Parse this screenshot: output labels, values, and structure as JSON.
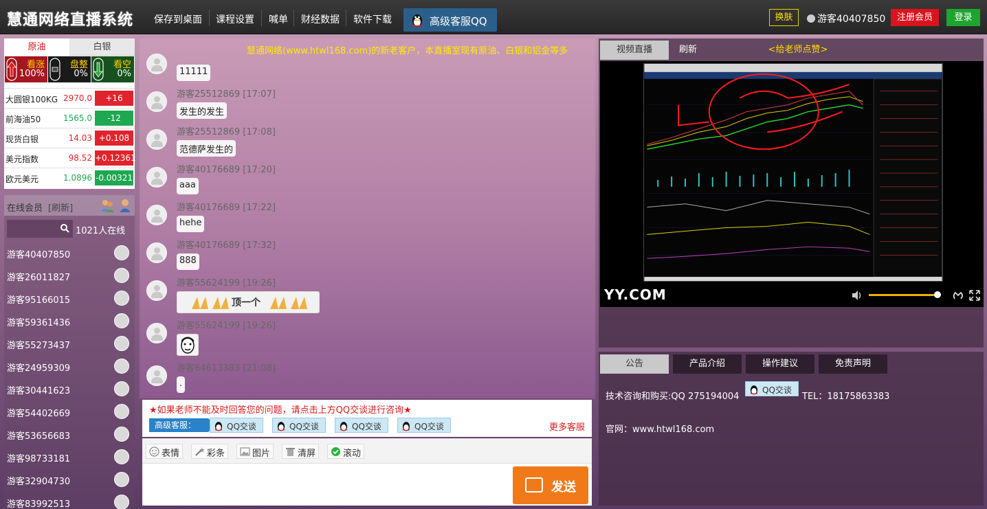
{
  "header": {
    "logo": "慧通网络直播系统",
    "nav": [
      "保存到桌面",
      "课程设置",
      "喊单",
      "财经数据",
      "软件下载"
    ],
    "qq_service": "高级客服QQ",
    "skin": "换肤",
    "username": "游客40407850",
    "register": "注册会员",
    "login": "登录"
  },
  "market": {
    "tabs": [
      "原油",
      "白银"
    ],
    "sentiment": [
      {
        "label": "看涨",
        "pct": "100%"
      },
      {
        "label": "盘整",
        "pct": "0%"
      },
      {
        "label": "看空",
        "pct": "0%"
      }
    ],
    "quotes": [
      {
        "name": "大圆银100KG",
        "price": "2970.0",
        "change": "+16"
      },
      {
        "name": "前海油50",
        "price": "1565.0",
        "change": "-12"
      },
      {
        "name": "现货白银",
        "price": "14.03",
        "change": "+0.108"
      },
      {
        "name": "美元指数",
        "price": "98.52",
        "change": "+0.12361"
      },
      {
        "name": "欧元美元",
        "price": "1.0896",
        "change": "-0.00321"
      }
    ],
    "colors": {
      "up": "#e0242e",
      "down": "#1ea852"
    }
  },
  "online": {
    "title": "在线会员",
    "refresh": "[刷新]",
    "count": "1021人在线",
    "users": [
      "游客40407850",
      "游客26011827",
      "游客95166015",
      "游客59361436",
      "游客55273437",
      "游客24959309",
      "游客30441623",
      "游客54402669",
      "游客53656683",
      "游客98733181",
      "游客32904730",
      "游客83992513"
    ]
  },
  "chat": {
    "marquee": "慧通网络(www.htwl168.com)的新老客户，本直播室现有原油、白银和铝金等多",
    "messages": [
      {
        "meta": "",
        "text": "11111"
      },
      {
        "meta": "游客25512869 [17:07]",
        "text": "发生的发生"
      },
      {
        "meta": "游客25512869 [17:08]",
        "text": "范德萨发生的"
      },
      {
        "meta": "游客40176689 [17:20]",
        "text": "aaa"
      },
      {
        "meta": "游客40176689 [17:22]",
        "text": "hehe"
      },
      {
        "meta": "游客40176689 [17:32]",
        "text": "888"
      },
      {
        "meta": "游客55624199 [19:26]",
        "text": "顶一个"
      },
      {
        "meta": "游客55624199 [19:26]",
        "text": ""
      },
      {
        "meta": "游客64613383 [21:08]",
        "text": "."
      }
    ],
    "notice": "★如果老师不能及时回答您的问题，请点击上方QQ交谈进行咨询★",
    "senior_label": "高级客服：",
    "qq_chip": "QQ交谈",
    "more_service": "更多客服",
    "tools": [
      "表情",
      "彩条",
      "图片",
      "清屏",
      "滚动"
    ],
    "send": "发送"
  },
  "video": {
    "tabs": [
      "视频直播",
      "刷新"
    ],
    "like": "<给老师点赞>",
    "logo": "YY.COM"
  },
  "info": {
    "tabs": [
      "公告",
      "产品介绍",
      "操作建议",
      "免责声明"
    ],
    "line1": "技术咨询和购买:QQ 275194004",
    "qq_chip": "QQ交谈",
    "tel": "TEL：18175863383",
    "site": "官网：www.htwl168.com"
  }
}
